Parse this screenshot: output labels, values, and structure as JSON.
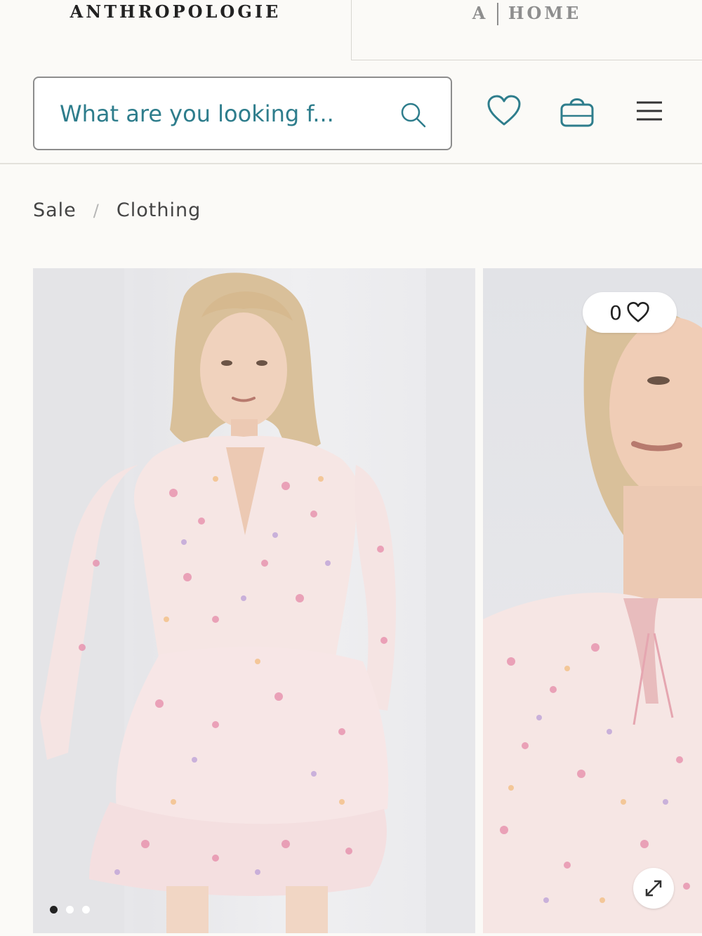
{
  "brands": {
    "primary": "ANTHROPOLOGIE",
    "home_mark": "A",
    "home_label": "HOME"
  },
  "search": {
    "placeholder": "What are you looking f..."
  },
  "header_icons": [
    "heart-icon",
    "shopping-bag-icon",
    "hamburger-menu-icon"
  ],
  "breadcrumb": {
    "items": [
      "Sale",
      "Clothing"
    ],
    "separator": "/"
  },
  "product": {
    "wishlist_count": "0",
    "gallery": {
      "image_count": 3,
      "active_index": 0
    }
  },
  "colors": {
    "accent": "#2e7d8c",
    "text": "#222222",
    "border": "#8d8d8d"
  }
}
